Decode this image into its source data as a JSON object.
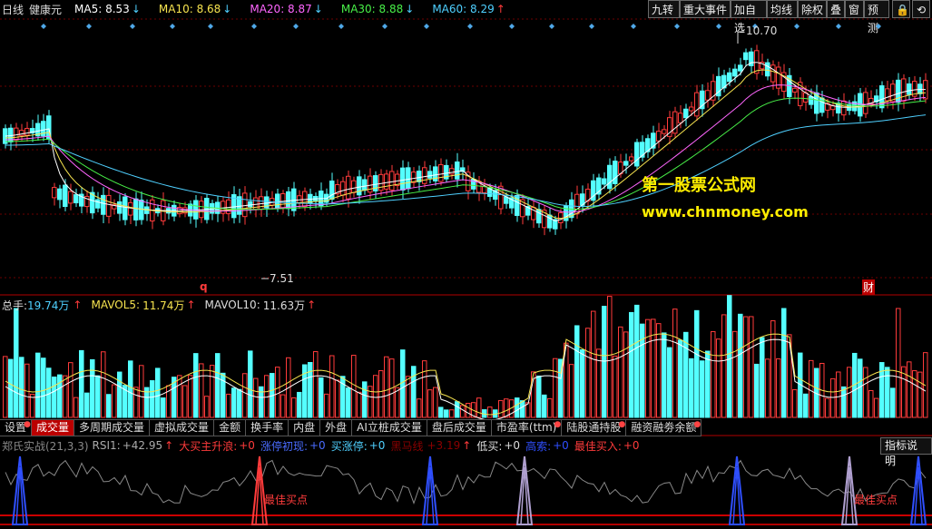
{
  "colors": {
    "up": "#ff3b3b",
    "down": "#54ffff",
    "ma5": "#ffffff",
    "ma10": "#f7e44f",
    "ma20": "#ff66ff",
    "ma30": "#48f048",
    "ma60": "#4fd0ff",
    "grid": "#b00000"
  },
  "header": {
    "period": "日线",
    "stock_name": "健康元",
    "ma": [
      {
        "label": "MA5:",
        "value": "8.53",
        "arrow": "down",
        "color": "#ffffff"
      },
      {
        "label": "MA10:",
        "value": "8.68",
        "arrow": "down",
        "color": "#f7e44f"
      },
      {
        "label": "MA20:",
        "value": "8.87",
        "arrow": "down",
        "color": "#ff66ff"
      },
      {
        "label": "MA30:",
        "value": "8.88",
        "arrow": "down",
        "color": "#48f048"
      },
      {
        "label": "MA60:",
        "value": "8.29",
        "arrow": "up",
        "color": "#4fd0ff"
      }
    ]
  },
  "toolbar": [
    "九转",
    "重大事件",
    "加自选",
    "均线",
    "除权",
    "叠",
    "窗",
    "预测"
  ],
  "price_labels": {
    "high": "10.70",
    "low": "7.51",
    "marker_q": "q",
    "marker_cai": "财"
  },
  "watermark": {
    "line1": "第一股票公式网",
    "line2": "www.chnmoney.com"
  },
  "volume_legend": {
    "total_label": "总手:",
    "total_value": "19.74万",
    "mavol5_label": "MAVOL5:",
    "mavol5_value": "11.74万",
    "mavol10_label": "MAVOL10:",
    "mavol10_value": "11.63万"
  },
  "tabs": [
    {
      "label": "设置",
      "dot": true,
      "active": false
    },
    {
      "label": "成交量",
      "dot": false,
      "active": true
    },
    {
      "label": "多周期成交量",
      "dot": false,
      "active": false
    },
    {
      "label": "虚拟成交量",
      "dot": false,
      "active": false
    },
    {
      "label": "金额",
      "dot": false,
      "active": false
    },
    {
      "label": "换手率",
      "dot": false,
      "active": false
    },
    {
      "label": "内盘",
      "dot": false,
      "active": false
    },
    {
      "label": "外盘",
      "dot": false,
      "active": false
    },
    {
      "label": "AI立桩成交量",
      "dot": false,
      "active": false
    },
    {
      "label": "盘后成交量",
      "dot": false,
      "active": false
    },
    {
      "label": "市盈率(ttm)",
      "dot": true,
      "active": false
    },
    {
      "label": "陆股通持股",
      "dot": true,
      "active": false
    },
    {
      "label": "融资融劵余额",
      "dot": true,
      "active": false
    }
  ],
  "indicator": {
    "name": "郑氏实战(21,3,3)",
    "rsi1_label": "RSI1:",
    "rsi1_value": "+42.95",
    "buy_label": "大买主升浪:",
    "buy_value": "+0",
    "limit_label": "涨停初现:",
    "limit_value": "+0",
    "buy_limit_label": "买涨停:",
    "buy_limit_value": "+0",
    "darkhorse_label": "黑马线",
    "darkhorse_value": "+3.19",
    "low_label": "低买:",
    "low_value": "+0",
    "gold_label": "高索:",
    "gold_value": "+0",
    "best_label": "最佳买入:",
    "best_value": "+0",
    "explain_button": "指标说明",
    "signal_text": "最佳买点"
  }
}
